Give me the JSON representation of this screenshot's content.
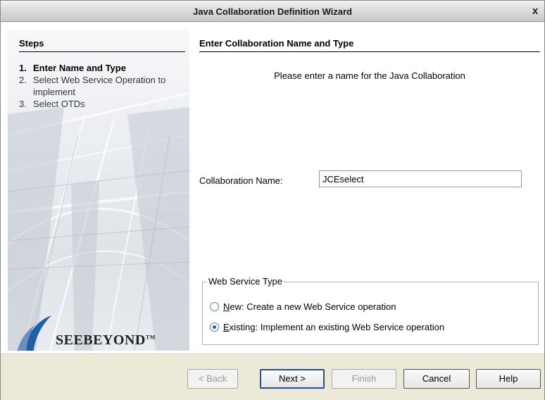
{
  "window": {
    "title": "Java Collaboration Definition Wizard",
    "close_glyph": "x"
  },
  "steps": {
    "title": "Steps",
    "items": [
      {
        "num": "1.",
        "label": "Enter Name and Type",
        "active": true
      },
      {
        "num": "2.",
        "label": "Select Web Service Operation to implement",
        "active": false
      },
      {
        "num": "3.",
        "label": "Select OTDs",
        "active": false
      }
    ]
  },
  "logo": {
    "text": "SEEBEYOND",
    "tm": "TM"
  },
  "main": {
    "title": "Enter Collaboration Name and Type",
    "instruction": "Please enter a name for the Java Collaboration",
    "name_label": "Collaboration Name:",
    "name_value": "JCEselect"
  },
  "web_service_type": {
    "legend": "Web Service Type",
    "options": [
      {
        "mnemonic": "N",
        "rest": "ew: Create a new Web Service operation",
        "selected": false
      },
      {
        "mnemonic": "E",
        "rest": "xisting: Implement an existing Web Service operation",
        "selected": true
      }
    ]
  },
  "buttons": {
    "back": "< Back",
    "next": "Next >",
    "finish": "Finish",
    "cancel": "Cancel",
    "help": "Help"
  }
}
